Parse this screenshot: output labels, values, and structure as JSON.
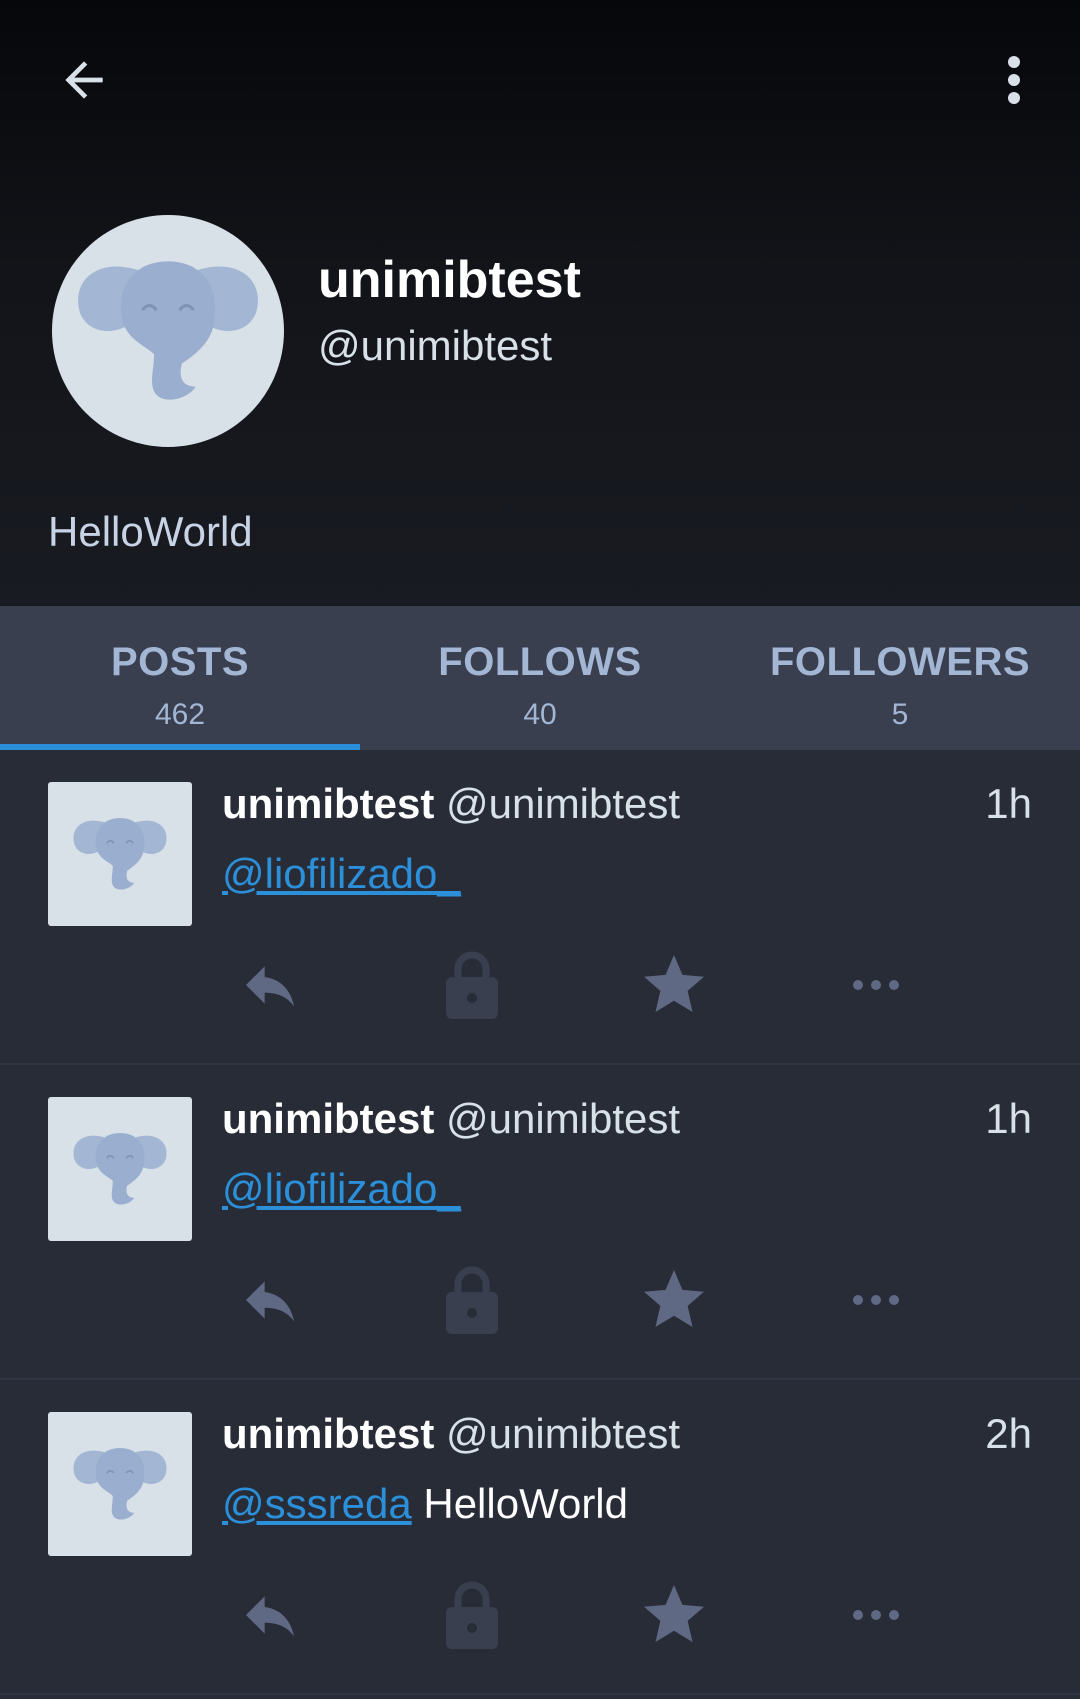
{
  "profile": {
    "display_name": "unimibtest",
    "handle": "@unimibtest",
    "bio": "HelloWorld"
  },
  "tabs": [
    {
      "label": "POSTS",
      "count": "462",
      "active": true
    },
    {
      "label": "FOLLOWS",
      "count": "40",
      "active": false
    },
    {
      "label": "FOLLOWERS",
      "count": "5",
      "active": false
    }
  ],
  "posts": [
    {
      "name": "unimibtest",
      "handle": "@unimibtest",
      "time": "1h",
      "mention": "@liofilizado_",
      "text": ""
    },
    {
      "name": "unimibtest",
      "handle": "@unimibtest",
      "time": "1h",
      "mention": "@liofilizado_",
      "text": ""
    },
    {
      "name": "unimibtest",
      "handle": "@unimibtest",
      "time": "2h",
      "mention": "@sssreda",
      "text": " HelloWorld"
    }
  ],
  "icons": {
    "back": "arrow-left-icon",
    "menu": "more-vertical-icon",
    "reply": "reply-icon",
    "privacy": "lock-icon",
    "favourite": "star-icon",
    "more": "more-horizontal-icon"
  },
  "colors": {
    "accent": "#2b90d9",
    "background": "#282c37",
    "tab_bar": "#393f4f",
    "action_icon": "#606984",
    "lock_icon": "#393f4f"
  }
}
